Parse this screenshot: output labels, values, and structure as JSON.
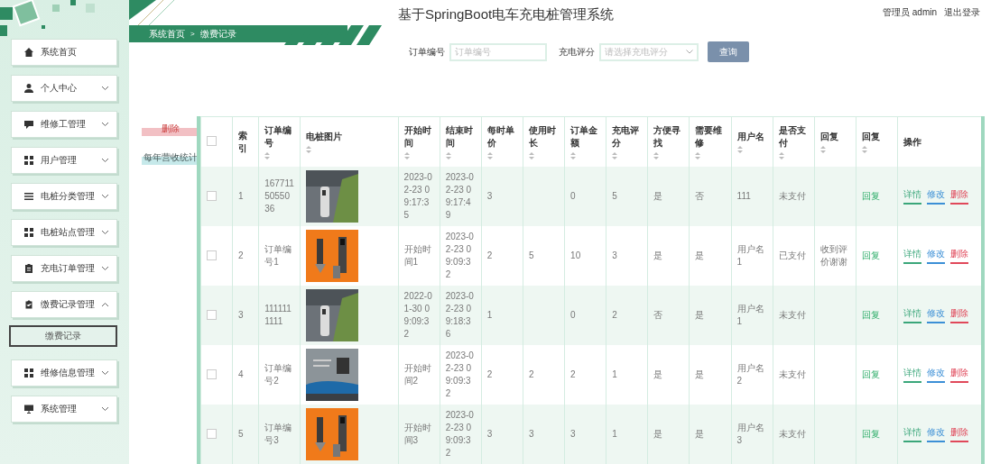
{
  "sidebar": {
    "items": [
      {
        "label": "系统首页"
      },
      {
        "label": "个人中心",
        "expanded": false
      },
      {
        "label": "维修工管理",
        "expanded": false
      },
      {
        "label": "用户管理",
        "expanded": false
      },
      {
        "label": "电桩分类管理",
        "expanded": false
      },
      {
        "label": "电桩站点管理",
        "expanded": false
      },
      {
        "label": "充电订单管理",
        "expanded": false
      },
      {
        "label": "缴费记录管理",
        "expanded": true,
        "children": [
          {
            "label": "缴费记录",
            "selected": true
          }
        ]
      },
      {
        "label": "维修信息管理",
        "expanded": false
      },
      {
        "label": "系统管理",
        "expanded": false
      }
    ]
  },
  "header": {
    "title": "基于SpringBoot电车充电桩管理系统",
    "user": "管理员 admin",
    "logout": "退出登录"
  },
  "breadcrumb": {
    "items": [
      "系统首页",
      "缴费记录"
    ],
    "separator": ">"
  },
  "search": {
    "fields": [
      {
        "kind": "input",
        "label": "订单编号",
        "placeholder": "订单编号"
      },
      {
        "kind": "select",
        "label": "充电评分",
        "placeholder": "请选择充电评分"
      }
    ],
    "button": "查询"
  },
  "actions": [
    "删除",
    "每年营收统计"
  ],
  "table": {
    "header_checked": false,
    "columns": [
      {
        "kind": "checkbox"
      },
      {
        "kind": "text",
        "label": "索引",
        "sortable": false
      },
      {
        "kind": "text",
        "label": "订单编号",
        "sortable": true
      },
      {
        "label": "电桩图片",
        "sortable": true
      },
      {
        "kind": "text",
        "label": "开始时间",
        "sortable": true
      },
      {
        "kind": "text",
        "label": "结束时间",
        "sortable": true
      },
      {
        "kind": "text",
        "label": "每时单价",
        "sortable": true
      },
      {
        "kind": "text",
        "label": "使用时长",
        "sortable": true
      },
      {
        "kind": "text",
        "label": "订单金额",
        "sortable": true
      },
      {
        "kind": "text",
        "label": "充电评分",
        "sortable": true
      },
      {
        "kind": "text",
        "label": "方便寻找",
        "sortable": true
      },
      {
        "kind": "text",
        "label": "需要维修",
        "sortable": true
      },
      {
        "kind": "text",
        "label": "用户名",
        "sortable": true
      },
      {
        "kind": "text",
        "label": "是否支付",
        "sortable": true
      },
      {
        "kind": "text",
        "label": "回复",
        "sortable": true
      },
      {
        "kind": "link",
        "label": "回复",
        "sortable": true
      },
      {
        "kind": "actions",
        "label": "操作",
        "sortable": false
      }
    ],
    "rows": [
      {
        "checked": false,
        "index": "1",
        "order_no": "1677115055036",
        "start": "2023-02-23 09:17:35",
        "end": "2023-02-23 09:17:49",
        "price": "3",
        "amount": "0",
        "rating": "5",
        "easy_find": "是",
        "repair": "否",
        "user": "111",
        "paid": "未支付",
        "reply_link": "回复",
        "ops": [
          "详情",
          "修改",
          "删除"
        ]
      },
      {
        "checked": false,
        "index": "2",
        "order_no": "订单编号1",
        "start": "开始时间1",
        "end": "2023-02-23 09:09:32",
        "price": "2",
        "duration": "5",
        "amount": "10",
        "rating": "3",
        "easy_find": "是",
        "repair": "是",
        "user": "用户名1",
        "paid": "已支付",
        "reply": "收到评价谢谢",
        "reply_link": "回复",
        "ops": [
          "详情",
          "修改",
          "删除"
        ]
      },
      {
        "checked": false,
        "index": "3",
        "order_no": "1111111111",
        "start": "2022-01-30 09:09:32",
        "end": "2023-02-23 09:18:36",
        "price": "1",
        "amount": "0",
        "rating": "2",
        "easy_find": "否",
        "repair": "是",
        "user": "用户名1",
        "paid": "未支付",
        "reply_link": "回复",
        "ops": [
          "详情",
          "修改",
          "删除"
        ]
      },
      {
        "checked": false,
        "index": "4",
        "order_no": "订单编号2",
        "start": "开始时间2",
        "end": "2023-02-23 09:09:32",
        "price": "2",
        "duration": "2",
        "amount": "2",
        "rating": "1",
        "easy_find": "是",
        "repair": "是",
        "user": "用户名2",
        "paid": "未支付",
        "reply_link": "回复",
        "ops": [
          "详情",
          "修改",
          "删除"
        ]
      },
      {
        "checked": false,
        "index": "5",
        "order_no": "订单编号3",
        "start": "开始时间3",
        "end": "2023-02-23 09:09:32",
        "price": "3",
        "duration": "3",
        "amount": "3",
        "rating": "1",
        "easy_find": "是",
        "repair": "是",
        "user": "用户名3",
        "paid": "未支付",
        "reply_link": "回复",
        "ops": [
          "详情",
          "修改",
          "删除"
        ]
      }
    ]
  }
}
